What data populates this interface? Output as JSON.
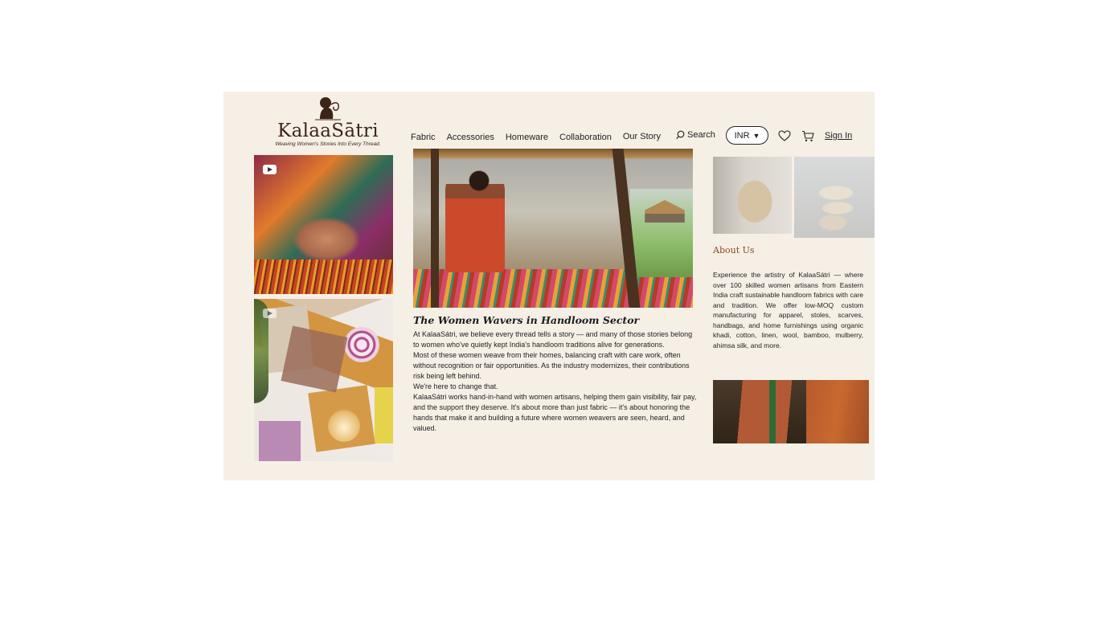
{
  "brand": {
    "name": "KalaaSātri",
    "tagline": "Weaving Women's Stories Into Every Thread."
  },
  "nav": {
    "items": [
      "Fabric",
      "Accessories",
      "Homeware",
      "Collaboration",
      "Our Story"
    ],
    "search_label": "Search",
    "currency": "INR",
    "sign_in": "Sign In"
  },
  "icons": {
    "search": "search-icon",
    "currency_caret": "chevron-down-icon",
    "wishlist": "heart-icon",
    "cart": "cart-icon",
    "video": "video-play-icon"
  },
  "article": {
    "title": "The Women Wavers in Handloom Sector",
    "paragraphs": [
      "At KalaaSátri, we believe every thread tells a story — and many of those stories belong to women who've quietly kept India's handloom traditions alive for generations.",
      "Most of these women weave from their homes, balancing craft with care work, often without recognition or fair opportunities. As the industry modernizes, their contributions risk being left behind.",
      "We're here to change that.",
      "KalaaSátri works hand-in-hand with women artisans, helping them gain visibility, fair pay, and the support they deserve. It's about more than just fabric — it's about honoring the hands that make it and building a future where women weavers are seen, heard, and valued."
    ]
  },
  "about": {
    "title": "About Us",
    "body": "Experience the artistry of KalaaSátri — where over 100 skilled women artisans from Eastern India craft sustainable handloom fabrics with care and tradition. We offer low-MOQ custom manufacturing for apparel, stoles, scarves, handbags, and home furnishings using organic khadi, cotton, linen, wool, bamboo, mulberry, ahimsa silk, and more."
  },
  "colors": {
    "background": "#f6efe6",
    "brand": "#3d2418",
    "accent": "#8b4a24"
  }
}
